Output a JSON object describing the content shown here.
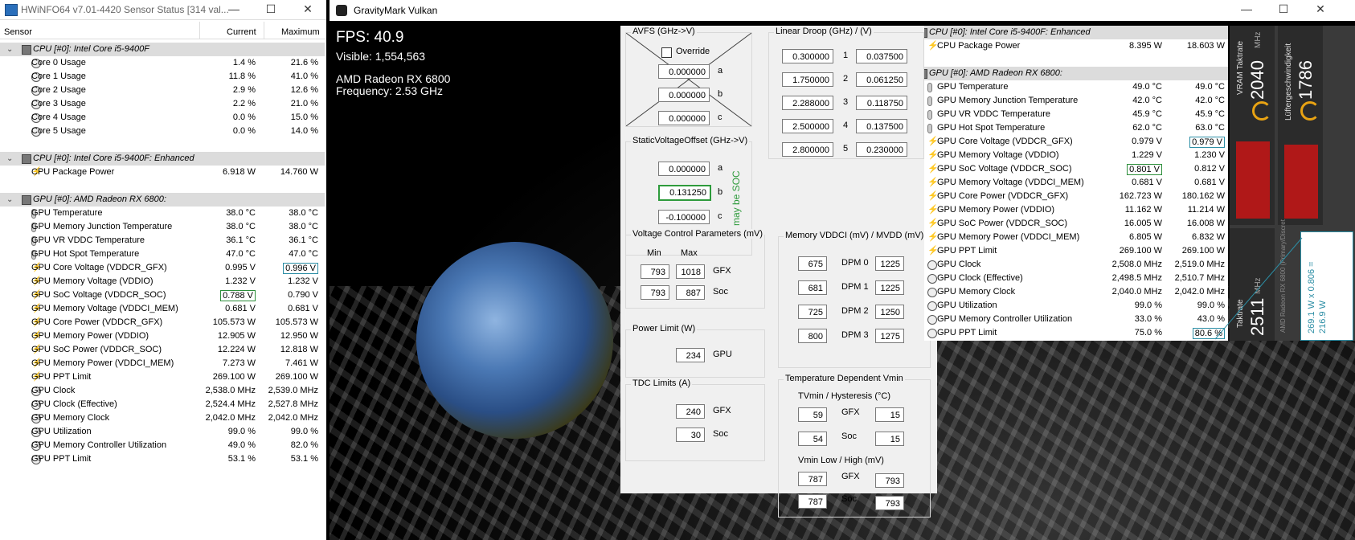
{
  "hwinfo_left": {
    "title": "HWiNFO64 v7.01-4420 Sensor Status [314 val...",
    "controls": {
      "minimize": "—",
      "maximize": "☐",
      "close": "✕"
    },
    "columns": {
      "sensor": "Sensor",
      "current": "Current",
      "maximum": "Maximum"
    },
    "rows": [
      {
        "type": "group",
        "label": "CPU [#0]: Intel Core i5-9400F",
        "current": "",
        "max": ""
      },
      {
        "type": "gauge",
        "label": "Core 0 Usage",
        "current": "1.4 %",
        "max": "21.6 %"
      },
      {
        "type": "gauge",
        "label": "Core 1 Usage",
        "current": "11.8 %",
        "max": "41.0 %"
      },
      {
        "type": "gauge",
        "label": "Core 2 Usage",
        "current": "2.9 %",
        "max": "12.6 %"
      },
      {
        "type": "gauge",
        "label": "Core 3 Usage",
        "current": "2.2 %",
        "max": "21.0 %"
      },
      {
        "type": "gauge",
        "label": "Core 4 Usage",
        "current": "0.0 %",
        "max": "15.0 %"
      },
      {
        "type": "gauge",
        "label": "Core 5 Usage",
        "current": "0.0 %",
        "max": "14.0 %"
      },
      {
        "type": "blank",
        "label": "",
        "current": "",
        "max": ""
      },
      {
        "type": "group",
        "label": "CPU [#0]: Intel Core i5-9400F: Enhanced",
        "current": "",
        "max": ""
      },
      {
        "type": "bolt",
        "label": "CPU Package Power",
        "current": "6.918 W",
        "max": "14.760 W"
      },
      {
        "type": "blank",
        "label": "",
        "current": "",
        "max": ""
      },
      {
        "type": "group",
        "label": "GPU [#0]: AMD Radeon RX 6800:",
        "current": "",
        "max": ""
      },
      {
        "type": "therm",
        "label": "GPU Temperature",
        "current": "38.0 °C",
        "max": "38.0 °C"
      },
      {
        "type": "therm",
        "label": "GPU Memory Junction Temperature",
        "current": "38.0 °C",
        "max": "38.0 °C"
      },
      {
        "type": "therm",
        "label": "GPU VR VDDC Temperature",
        "current": "36.1 °C",
        "max": "36.1 °C"
      },
      {
        "type": "therm",
        "label": "GPU Hot Spot Temperature",
        "current": "47.0 °C",
        "max": "47.0 °C"
      },
      {
        "type": "bolt",
        "label": "GPU Core Voltage (VDDCR_GFX)",
        "current": "0.995 V",
        "max": "0.996 V",
        "max_boxed": true
      },
      {
        "type": "bolt",
        "label": "GPU Memory Voltage (VDDIO)",
        "current": "1.232 V",
        "max": "1.232 V"
      },
      {
        "type": "bolt",
        "label": "GPU SoC Voltage (VDDCR_SOC)",
        "current": "0.788 V",
        "max": "0.790 V",
        "cur_green": true
      },
      {
        "type": "bolt",
        "label": "GPU Memory Voltage (VDDCI_MEM)",
        "current": "0.681 V",
        "max": "0.681 V"
      },
      {
        "type": "bolt",
        "label": "GPU Core Power (VDDCR_GFX)",
        "current": "105.573 W",
        "max": "105.573 W"
      },
      {
        "type": "bolt",
        "label": "GPU Memory Power (VDDIO)",
        "current": "12.905 W",
        "max": "12.950 W"
      },
      {
        "type": "bolt",
        "label": "GPU SoC Power (VDDCR_SOC)",
        "current": "12.224 W",
        "max": "12.818 W"
      },
      {
        "type": "bolt",
        "label": "GPU Memory Power (VDDCI_MEM)",
        "current": "7.273 W",
        "max": "7.461 W"
      },
      {
        "type": "bolt",
        "label": "GPU PPT Limit",
        "current": "269.100 W",
        "max": "269.100 W"
      },
      {
        "type": "gauge",
        "label": "GPU Clock",
        "current": "2,538.0 MHz",
        "max": "2,539.0 MHz"
      },
      {
        "type": "gauge",
        "label": "GPU Clock (Effective)",
        "current": "2,524.4 MHz",
        "max": "2,527.8 MHz"
      },
      {
        "type": "gauge",
        "label": "GPU Memory Clock",
        "current": "2,042.0 MHz",
        "max": "2,042.0 MHz"
      },
      {
        "type": "gauge",
        "label": "GPU Utilization",
        "current": "99.0 %",
        "max": "99.0 %"
      },
      {
        "type": "gauge",
        "label": "GPU Memory Controller Utilization",
        "current": "49.0 %",
        "max": "82.0 %"
      },
      {
        "type": "gauge",
        "label": "GPU PPT Limit",
        "current": "53.1 %",
        "max": "53.1 %"
      }
    ]
  },
  "gravitymark": {
    "title": "GravityMark Vulkan",
    "controls": {
      "minimize": "—",
      "maximize": "☐",
      "close": "✕"
    },
    "fps": "FPS: 40.9",
    "visible": "Visible: 1,554,563",
    "gpu": "AMD Radeon RX 6800",
    "frequency": "Frequency: 2.53 GHz"
  },
  "mpt": {
    "avfs": {
      "title": "AVFS (GHz->V)",
      "override": "Override",
      "a": "0.000000",
      "b": "0.000000",
      "c": "0.000000",
      "labels": [
        "a",
        "b",
        "c"
      ]
    },
    "linear_droop": {
      "title": "Linear Droop (GHz) / (V)",
      "rows": [
        {
          "ghz": "0.300000",
          "n": "1",
          "v": "0.037500"
        },
        {
          "ghz": "1.750000",
          "n": "2",
          "v": "0.061250"
        },
        {
          "ghz": "2.288000",
          "n": "3",
          "v": "0.118750"
        },
        {
          "ghz": "2.500000",
          "n": "4",
          "v": "0.137500"
        },
        {
          "ghz": "2.800000",
          "n": "5",
          "v": "0.230000"
        }
      ]
    },
    "svo": {
      "title": "StaticVoltageOffset (GHz->V)",
      "a": "0.000000",
      "b": "0.131250",
      "c": "-0.100000",
      "labels": [
        "a",
        "b",
        "c"
      ],
      "note": "may be SOC"
    },
    "vcp": {
      "title": "Voltage Control Parameters (mV)",
      "min": "Min",
      "max": "Max",
      "gfx_min": "793",
      "gfx_max": "1018",
      "gfx": "GFX",
      "soc_min": "793",
      "soc_max": "887",
      "soc": "Soc"
    },
    "power_limit": {
      "title": "Power Limit (W)",
      "value": "234",
      "label": "GPU"
    },
    "tdc": {
      "title": "TDC Limits (A)",
      "gfx_value": "240",
      "gfx": "GFX",
      "soc_value": "30",
      "soc": "Soc"
    },
    "mem": {
      "title": "Memory VDDCI (mV) / MVDD (mV)",
      "rows": [
        {
          "vddci": "675",
          "dpm": "DPM 0",
          "mvdd": "1225"
        },
        {
          "vddci": "681",
          "dpm": "DPM 1",
          "mvdd": "1225"
        },
        {
          "vddci": "725",
          "dpm": "DPM 2",
          "mvdd": "1250"
        },
        {
          "vddci": "800",
          "dpm": "DPM 3",
          "mvdd": "1275"
        }
      ]
    },
    "tdv": {
      "title": "Temperature Dependent Vmin",
      "tvmin": "TVmin / Hysteresis (°C)",
      "gfx": "GFX",
      "soc": "Soc",
      "gfx_t": "59",
      "gfx_h": "15",
      "soc_t": "54",
      "soc_h": "15",
      "vmin": "Vmin Low / High (mV)",
      "gfx_low": "787",
      "gfx_high": "793",
      "soc_low": "787",
      "soc_high": "793"
    }
  },
  "hwinfo_right": {
    "rows": [
      {
        "type": "group",
        "label": "CPU [#0]: Intel Core i5-9400F: Enhanced",
        "current": "",
        "max": ""
      },
      {
        "type": "bolt",
        "label": "CPU Package Power",
        "current": "8.395 W",
        "max": "18.603 W"
      },
      {
        "type": "blank",
        "label": "",
        "current": "",
        "max": ""
      },
      {
        "type": "group",
        "label": "GPU [#0]: AMD Radeon RX 6800:",
        "current": "",
        "max": ""
      },
      {
        "type": "therm",
        "label": "GPU Temperature",
        "current": "49.0 °C",
        "max": "49.0 °C"
      },
      {
        "type": "therm",
        "label": "GPU Memory Junction Temperature",
        "current": "42.0 °C",
        "max": "42.0 °C"
      },
      {
        "type": "therm",
        "label": "GPU VR VDDC Temperature",
        "current": "45.9 °C",
        "max": "45.9 °C"
      },
      {
        "type": "therm",
        "label": "GPU Hot Spot Temperature",
        "current": "62.0 °C",
        "max": "63.0 °C"
      },
      {
        "type": "bolt",
        "label": "GPU Core Voltage (VDDCR_GFX)",
        "current": "0.979 V",
        "max": "0.979 V",
        "max_boxed": true
      },
      {
        "type": "bolt",
        "label": "GPU Memory Voltage (VDDIO)",
        "current": "1.229 V",
        "max": "1.230 V"
      },
      {
        "type": "bolt",
        "label": "GPU SoC Voltage (VDDCR_SOC)",
        "current": "0.801 V",
        "max": "0.812 V",
        "cur_green": true
      },
      {
        "type": "bolt",
        "label": "GPU Memory Voltage (VDDCI_MEM)",
        "current": "0.681 V",
        "max": "0.681 V"
      },
      {
        "type": "bolt",
        "label": "GPU Core Power (VDDCR_GFX)",
        "current": "162.723 W",
        "max": "180.162 W"
      },
      {
        "type": "bolt",
        "label": "GPU Memory Power (VDDIO)",
        "current": "11.162 W",
        "max": "11.214 W"
      },
      {
        "type": "bolt",
        "label": "GPU SoC Power (VDDCR_SOC)",
        "current": "16.005 W",
        "max": "16.008 W"
      },
      {
        "type": "bolt",
        "label": "GPU Memory Power (VDDCI_MEM)",
        "current": "6.805 W",
        "max": "6.832 W"
      },
      {
        "type": "bolt",
        "label": "GPU PPT Limit",
        "current": "269.100 W",
        "max": "269.100 W"
      },
      {
        "type": "gauge",
        "label": "GPU Clock",
        "current": "2,508.0 MHz",
        "max": "2,519.0 MHz"
      },
      {
        "type": "gauge",
        "label": "GPU Clock (Effective)",
        "current": "2,498.5 MHz",
        "max": "2,510.7 MHz"
      },
      {
        "type": "gauge",
        "label": "GPU Memory Clock",
        "current": "2,040.0 MHz",
        "max": "2,042.0 MHz"
      },
      {
        "type": "gauge",
        "label": "GPU Utilization",
        "current": "99.0 %",
        "max": "99.0 %"
      },
      {
        "type": "gauge",
        "label": "GPU Memory Controller Utilization",
        "current": "33.0 %",
        "max": "43.0 %"
      },
      {
        "type": "gauge",
        "label": "GPU PPT Limit",
        "current": "75.0 %",
        "max": "80.6 %",
        "max_boxed": true
      }
    ]
  },
  "side_panel": {
    "vram_label": "VRAM Taktrate",
    "vram_value": "2040",
    "vram_unit": "MHz",
    "fan_label": "Lüftergeschwindigkeit",
    "fan_value": "1786",
    "gpu_label": "Taktrate",
    "gpu_value": "2511",
    "gpu_unit": "MHz",
    "device": "AMD Radeon RX 6800 (Primary/Discret",
    "calc": "269.1 W x 0.806 = 216.9 W",
    "accent": "#e8a313",
    "bar_color": "#b01818"
  }
}
